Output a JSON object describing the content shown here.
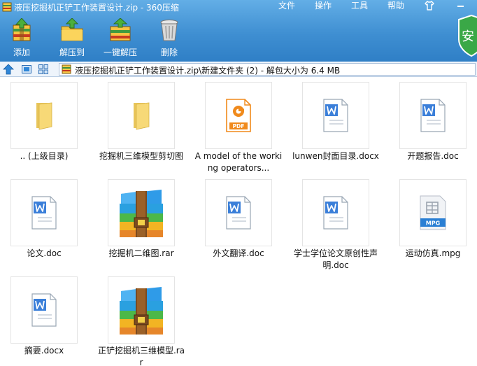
{
  "window": {
    "title": "液压挖掘机正铲工作装置设计.zip - 360压缩"
  },
  "menu": {
    "items": [
      "文件",
      "操作",
      "工具",
      "帮助"
    ]
  },
  "toolbar": {
    "add_label": "添加",
    "extract_label": "解压到",
    "oneclick_label": "一键解压",
    "delete_label": "删除"
  },
  "shield": {
    "label": "安"
  },
  "address": {
    "path": "液压挖掘机正铲工作装置设计.zip\\新建文件夹 (2) - 解包大小为 6.4 MB"
  },
  "files": [
    {
      "name": ".. (上级目录)",
      "icon": "folder-icon"
    },
    {
      "name": "挖掘机三维模型剪切图",
      "icon": "folder-icon"
    },
    {
      "name": "A model of the working operators...",
      "icon": "pdf-icon",
      "badge": "PDF"
    },
    {
      "name": "lunwen封面目录.docx",
      "icon": "word-doc-icon"
    },
    {
      "name": "开题报告.doc",
      "icon": "word-doc-icon"
    },
    {
      "name": "论文.doc",
      "icon": "word-doc-icon"
    },
    {
      "name": "挖掘机二维图.rar",
      "icon": "rar-archive-icon"
    },
    {
      "name": "外文翻译.doc",
      "icon": "word-doc-icon"
    },
    {
      "name": "学士学位论文原创性声明.doc",
      "icon": "word-doc-icon"
    },
    {
      "name": "运动仿真.mpg",
      "icon": "video-file-icon",
      "badge": "MPG"
    },
    {
      "name": "摘要.docx",
      "icon": "word-doc-icon"
    },
    {
      "name": "正铲挖掘机三维模型.rar",
      "icon": "rar-archive-icon"
    }
  ],
  "colors": {
    "toolbar_top": "#63aee6",
    "toolbar_bottom": "#2f7fc6",
    "folder": "#f5d774",
    "pdf": "#f08a1c",
    "word": "#3b7fd9",
    "mpg": "#2a7fd4"
  }
}
